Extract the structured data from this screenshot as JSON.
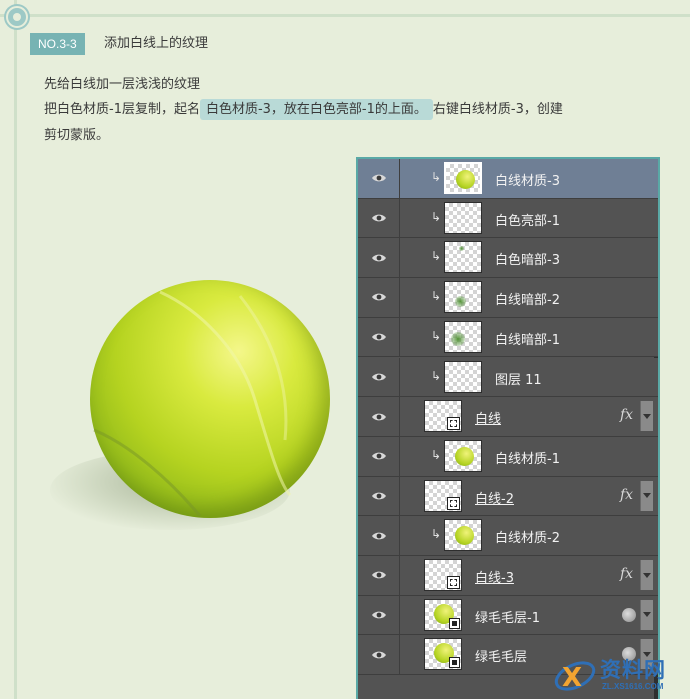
{
  "step": {
    "badge": "NO.3-3",
    "title": "添加白线上的纹理"
  },
  "instructions": {
    "line1": "先给白线加一层浅浅的纹理",
    "line2_before": "把白色材质-1层复制，起名",
    "line2_highlight": "白色材质-3，放在白色亮部-1的上面。",
    "line2_after": "右键白线材质-3，创建",
    "line3": "剪切蒙版。"
  },
  "layers": [
    {
      "name": "白线材质-3",
      "clipped": true,
      "thumb": "ball",
      "selected": true
    },
    {
      "name": "白色亮部-1",
      "clipped": true,
      "thumb": "transparent"
    },
    {
      "name": "白色暗部-3",
      "clipped": true,
      "thumb": "dot-small"
    },
    {
      "name": "白线暗部-2",
      "clipped": true,
      "thumb": "dot-medium"
    },
    {
      "name": "白线暗部-1",
      "clipped": true,
      "thumb": "dot-large"
    },
    {
      "name": "图层 11",
      "clipped": true,
      "thumb": "transparent"
    },
    {
      "name": "白线",
      "clipped": false,
      "thumb": "mask",
      "badge": "fx-icon"
    },
    {
      "name": "白线材质-1",
      "clipped": true,
      "thumb": "ball"
    },
    {
      "name": "白线-2",
      "clipped": false,
      "thumb": "mask",
      "badge": "fx-icon"
    },
    {
      "name": "白线材质-2",
      "clipped": true,
      "thumb": "ball"
    },
    {
      "name": "白线-3",
      "clipped": false,
      "thumb": "mask",
      "badge": "fx-icon"
    },
    {
      "name": "绿毛毛层-1",
      "clipped": false,
      "thumb": "ball-smart",
      "badge": "filter-circle-icon"
    },
    {
      "name": "绿毛毛层",
      "clipped": false,
      "thumb": "ball-smart",
      "badge": "filter-circle-icon"
    }
  ],
  "watermark": {
    "name": "资料网",
    "url": "ZL.XS1616.COM"
  },
  "colors": {
    "accent": "#77b3b3",
    "highlight": "#b9dad7",
    "panel": "#535353",
    "selected": "#6f7f95"
  }
}
